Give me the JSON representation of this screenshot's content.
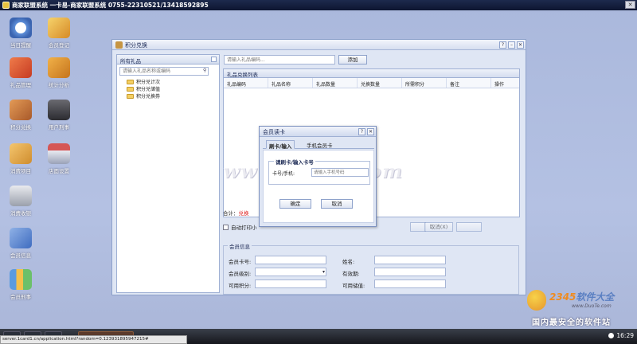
{
  "app": {
    "title": "商家联盟系统 一卡易-商家联盟系统 0755-22310521/13418592895"
  },
  "desktop": {
    "icons": [
      {
        "label": "当日提醒"
      },
      {
        "label": "会员登记"
      },
      {
        "label": "礼品管理"
      },
      {
        "label": "统计分析"
      },
      {
        "label": "积分兑换"
      },
      {
        "label": "用户刑事"
      },
      {
        "label": "消费项目"
      },
      {
        "label": "店面设置"
      },
      {
        "label": "消费收银"
      },
      {
        "label": "会员信息"
      },
      {
        "label": "会员刑事"
      }
    ]
  },
  "window": {
    "title": "积分兑换",
    "left_panel": {
      "title": "所有礼品",
      "search_placeholder": "请输入礼品名称或编码",
      "tree": [
        "积分兑计次",
        "积分兑储值",
        "积分兑换券"
      ]
    },
    "gift_search_placeholder": "请输入礼品编码...",
    "add_button": "添加",
    "gift_list": {
      "title": "礼品兑换列表",
      "columns": [
        "礼品编码",
        "礼品名称",
        "礼品数量",
        "兑换数量",
        "所需积分",
        "备注",
        "操作"
      ]
    },
    "total_label": "合计：",
    "total_value": "兑换",
    "autoprint_label": "自动打印小",
    "cancel_button": "取消(X)",
    "member": {
      "legend": "会员信息",
      "fields": [
        {
          "label": "会员卡号:"
        },
        {
          "label": "姓名:"
        },
        {
          "label": "会员级别:"
        },
        {
          "label": "有效期:"
        },
        {
          "label": "可用积分:"
        },
        {
          "label": "可用储值:"
        }
      ]
    }
  },
  "dialog": {
    "title": "会员读卡",
    "tabs": [
      "刷卡/输入",
      "手机会员卡"
    ],
    "group_legend": "请刷卡/输入卡号",
    "card_label": "卡号/手机:",
    "card_placeholder": "请输入手机号码",
    "ok_button": "确定",
    "cancel_button": "取消"
  },
  "watermark": "www.Duote.com",
  "brand": {
    "logo_prefix": "2345",
    "logo_suffix": "软件大全",
    "url": "www.DuoTe.com",
    "slogan": "国内最安全的软件站"
  },
  "taskbar": {
    "status_url": "server.1card1.cn/application.html?random=0.123931895947215#",
    "clock": "16:29"
  }
}
